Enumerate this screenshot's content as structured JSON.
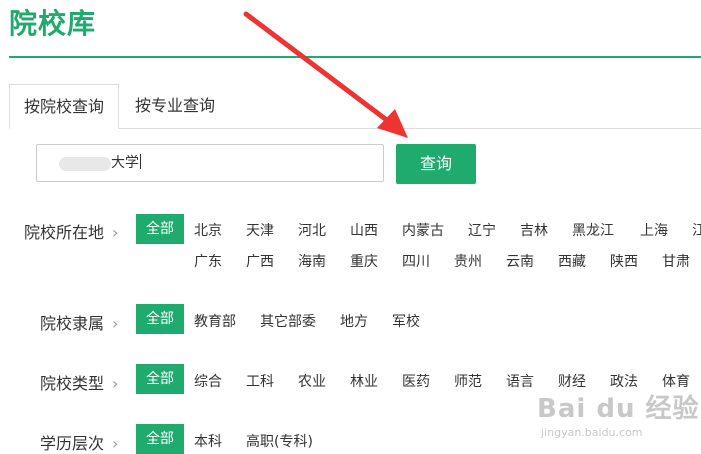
{
  "header": {
    "title": "院校库"
  },
  "tabs": [
    {
      "label": "按院校查询",
      "active": true
    },
    {
      "label": "按专业查询",
      "active": false
    }
  ],
  "search": {
    "value": "大学",
    "button_label": "查询"
  },
  "filters": {
    "location": {
      "label": "院校所在地",
      "all_label": "全部",
      "row1": [
        "北京",
        "天津",
        "河北",
        "山西",
        "内蒙古",
        "辽宁",
        "吉林",
        "黑龙江",
        "上海",
        "江"
      ],
      "row2": [
        "广东",
        "广西",
        "海南",
        "重庆",
        "四川",
        "贵州",
        "云南",
        "西藏",
        "陕西",
        "甘肃"
      ]
    },
    "affiliation": {
      "label": "院校隶属",
      "all_label": "全部",
      "options": [
        "教育部",
        "其它部委",
        "地方",
        "军校"
      ]
    },
    "type": {
      "label": "院校类型",
      "all_label": "全部",
      "options": [
        "综合",
        "工科",
        "农业",
        "林业",
        "医药",
        "师范",
        "语言",
        "财经",
        "政法",
        "体育"
      ]
    },
    "level": {
      "label": "学历层次",
      "all_label": "全部",
      "options": [
        "本科",
        "高职(专科)"
      ]
    }
  },
  "watermark": {
    "brand": "Bai du 经验",
    "url": "jingyan.baidu.com"
  },
  "colors": {
    "accent": "#1faa6e",
    "annotation_arrow": "#ee3333"
  }
}
